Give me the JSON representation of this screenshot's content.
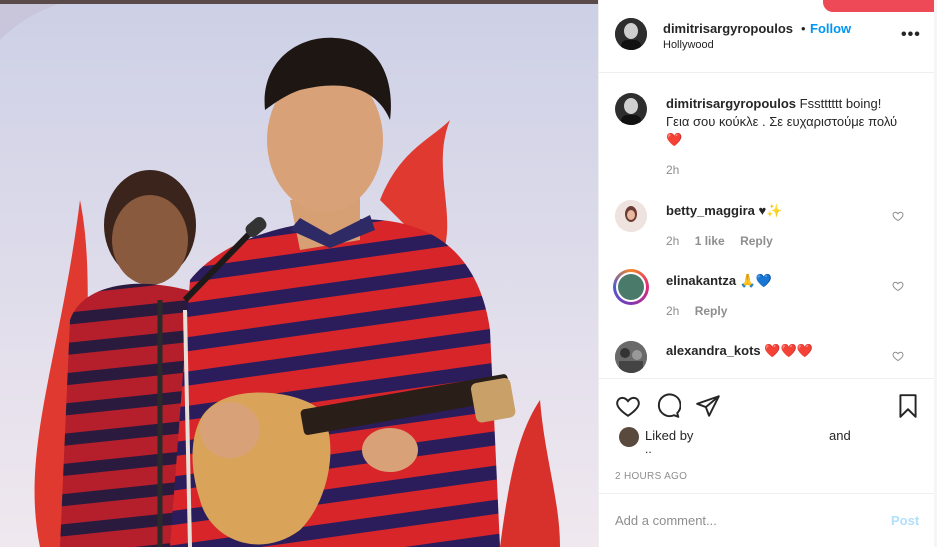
{
  "header": {
    "username": "dimitrisargyropoulos",
    "dot": "•",
    "follow_label": "Follow",
    "location": "Hollywood",
    "more_label": "•••"
  },
  "caption": {
    "username": "dimitrisargyropoulos",
    "text": "Fsstttttt boing! Γεια σου κούκλε . Σε ευχαριστούμε πολύ❤️",
    "time": "2h"
  },
  "comments": [
    {
      "username": "betty_maggira",
      "text": "♥✨",
      "time": "2h",
      "likes": "1 like",
      "reply": "Reply"
    },
    {
      "username": "elinakantza",
      "text": "🙏💙",
      "time": "2h",
      "reply": "Reply"
    },
    {
      "username": "alexandra_kots",
      "text": "❤️❤️❤️"
    }
  ],
  "actions": {
    "liked_by": "Liked by",
    "and": "and",
    "ellipsis": "..",
    "timestamp": "2 HOURS AGO"
  },
  "add_comment": {
    "placeholder": "Add a comment...",
    "post_label": "Post"
  },
  "colors": {
    "follow": "#0095f6",
    "post_disabled": "#b2dffc",
    "red_tab": "#ed4956",
    "meta_gray": "#8e8e8e"
  }
}
